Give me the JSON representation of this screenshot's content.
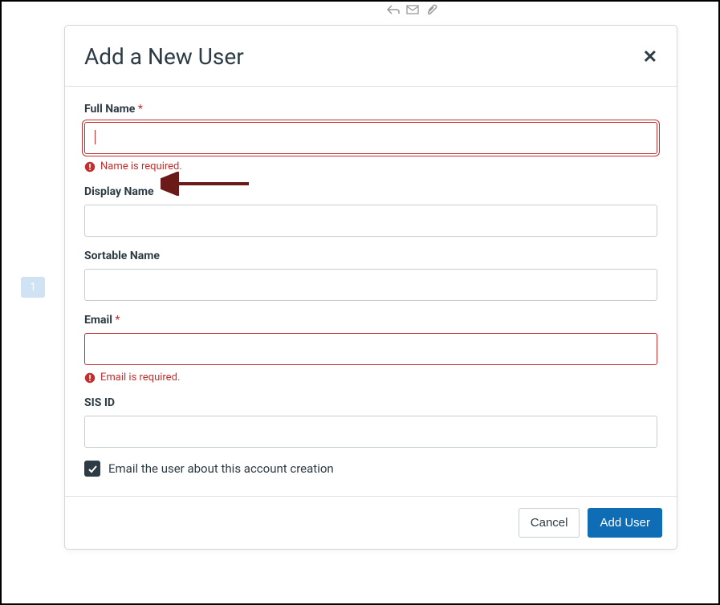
{
  "background": {
    "page_number": "1"
  },
  "modal": {
    "title": "Add a New User",
    "close_symbol": "✕",
    "fields": {
      "full_name": {
        "label": "Full Name",
        "required_mark": "*",
        "value": "",
        "error": "Name is required."
      },
      "display_name": {
        "label": "Display Name",
        "value": ""
      },
      "sortable_name": {
        "label": "Sortable Name",
        "value": ""
      },
      "email": {
        "label": "Email",
        "required_mark": "*",
        "value": "",
        "error": "Email is required."
      },
      "sis_id": {
        "label": "SIS ID",
        "value": ""
      }
    },
    "checkbox": {
      "checked": true,
      "label": "Email the user about this account creation"
    },
    "buttons": {
      "cancel": "Cancel",
      "submit": "Add User"
    }
  }
}
